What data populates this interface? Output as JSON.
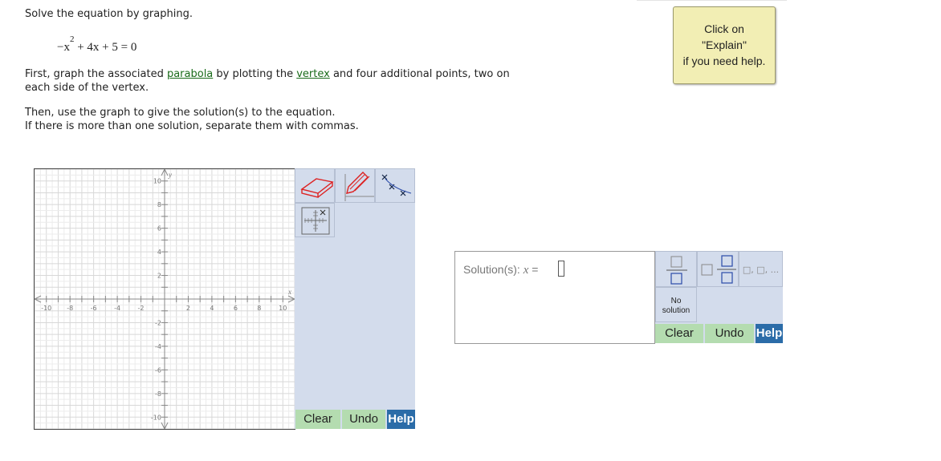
{
  "instructions": {
    "line1": "Solve the equation by graphing.",
    "equation": {
      "a": "−x",
      "exp": "2",
      "rest": " + 4x + 5 = 0"
    },
    "para1": {
      "pre": "First, graph the associated ",
      "link1": "parabola",
      "mid": " by plotting the ",
      "link2": "vertex",
      "post": " and four additional points, two on",
      "line2": "each side of the vertex."
    },
    "para2": {
      "line1": "Then, use the graph to give the solution(s) to the equation.",
      "line2": "If there is more than one solution, separate them with commas."
    }
  },
  "help_note": {
    "line1": "Click on",
    "line2": "\"Explain\"",
    "line3": "if you need help."
  },
  "graph": {
    "x_label": "x",
    "y_label": "y",
    "x_range": [
      -11,
      11
    ],
    "y_range": [
      -11,
      11
    ],
    "x_ticks": [
      "-10",
      "-8",
      "-6",
      "-4",
      "-2",
      "2",
      "4",
      "6",
      "8",
      "10"
    ],
    "y_ticks": [
      "10",
      "8",
      "6",
      "4",
      "2",
      "-2",
      "-4",
      "-6",
      "-8",
      "-10"
    ]
  },
  "graph_tools": {
    "tools": [
      "eraser-icon",
      "pencil-icon",
      "point-plot-icon",
      "grid-window-icon"
    ],
    "clear_label": "Clear",
    "undo_label": "Undo",
    "help_label": "Help"
  },
  "answer": {
    "label": "Solution(s): ",
    "var": "x",
    "equals": " = ",
    "palette": {
      "fraction": "fraction-icon",
      "mixed_number": "mixed-number-icon",
      "list": "□, □, ...",
      "no_solution_line1": "No",
      "no_solution_line2": "solution"
    },
    "clear_label": "Clear",
    "undo_label": "Undo",
    "help_label": "Help"
  },
  "colors": {
    "tool_panel": "#d3dcec",
    "button_green": "#b4dcb0",
    "button_blue": "#2b6ca8",
    "link": "#1a6b1a",
    "note_bg": "#f2eeb4"
  }
}
